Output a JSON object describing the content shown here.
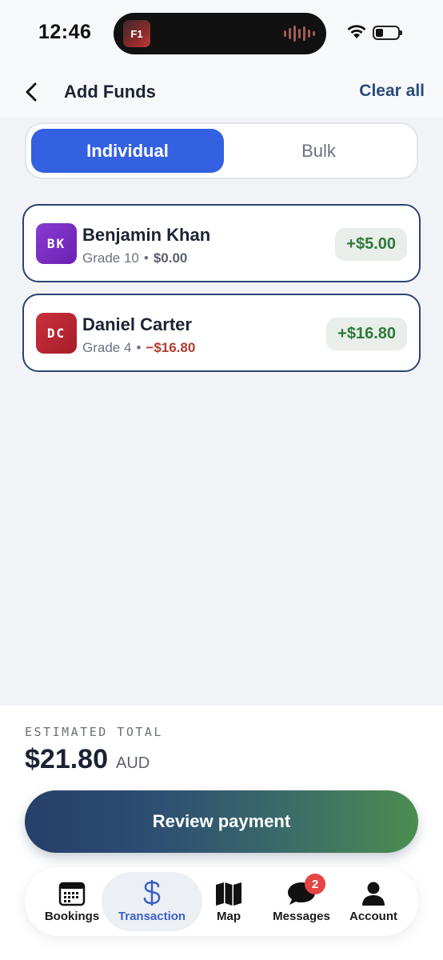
{
  "status_bar": {
    "time": "12:46",
    "island_app": "F1"
  },
  "header": {
    "title": "Add Funds",
    "clear_all": "Clear all"
  },
  "segmented": {
    "individual": "Individual",
    "bulk": "Bulk",
    "selected": "Individual"
  },
  "students": [
    {
      "initials": "BK",
      "name": "Benjamin Khan",
      "grade": "Grade 10",
      "separator": "•",
      "balance": "$0.00",
      "amount": "+$5.00",
      "avatar_color": "#7b2fc0",
      "balance_color": "#5b6170"
    },
    {
      "initials": "DC",
      "name": "Daniel Carter",
      "grade": "Grade 4",
      "separator": "•",
      "balance": "−$16.80",
      "amount": "+$16.80",
      "avatar_color": "#b8232f",
      "balance_color": "#b23b30"
    }
  ],
  "footer": {
    "estimated_label": "ESTIMATED TOTAL",
    "estimated_amount": "$21.80",
    "currency": "AUD",
    "review_button": "Review payment"
  },
  "tabs": [
    {
      "label": "Bookings",
      "icon": "calendar-icon"
    },
    {
      "label": "Transaction",
      "icon": "dollar-icon",
      "active": true
    },
    {
      "label": "Map",
      "icon": "map-icon"
    },
    {
      "label": "Messages",
      "icon": "chat-bubble-icon",
      "badge": "2"
    },
    {
      "label": "Account",
      "icon": "person-icon"
    }
  ],
  "colors": {
    "accent": "#3461e2",
    "positive": "#2e7a3a",
    "negative": "#b23b30",
    "navy": "#2a4470",
    "badge": "#e54545"
  }
}
